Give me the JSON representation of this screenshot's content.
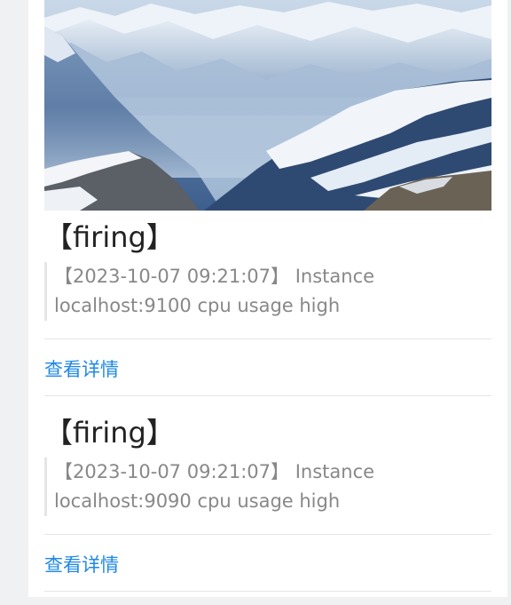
{
  "hero": {
    "image_alt": "Snowy mountain range landscape"
  },
  "alerts": [
    {
      "title": "【firing】",
      "message": "【2023-10-07 09:21:07】 Instance localhost:9100 cpu usage high",
      "link_label": "查看详情"
    },
    {
      "title": "【firing】",
      "message": "【2023-10-07 09:21:07】 Instance localhost:9090 cpu usage high",
      "link_label": "查看详情"
    }
  ],
  "colors": {
    "link": "#1e88e5",
    "title": "#222222",
    "quote_text": "#888888",
    "quote_border": "#e5e5e5",
    "page_bg": "#f0f1f3",
    "card_bg": "#ffffff"
  }
}
